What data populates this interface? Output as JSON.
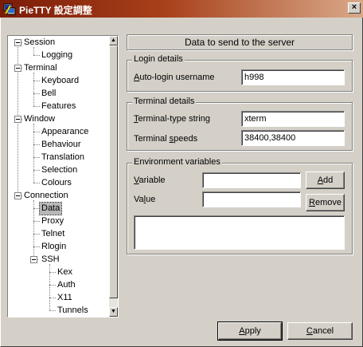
{
  "window": {
    "title": "PieTTY 設定調整",
    "close_glyph": "×"
  },
  "tree": {
    "items": [
      {
        "label": "Session",
        "level": 0,
        "expandable": true
      },
      {
        "label": "Logging",
        "level": 1
      },
      {
        "label": "Terminal",
        "level": 0,
        "expandable": true
      },
      {
        "label": "Keyboard",
        "level": 1
      },
      {
        "label": "Bell",
        "level": 1
      },
      {
        "label": "Features",
        "level": 1
      },
      {
        "label": "Window",
        "level": 0,
        "expandable": true
      },
      {
        "label": "Appearance",
        "level": 1
      },
      {
        "label": "Behaviour",
        "level": 1
      },
      {
        "label": "Translation",
        "level": 1
      },
      {
        "label": "Selection",
        "level": 1
      },
      {
        "label": "Colours",
        "level": 1
      },
      {
        "label": "Connection",
        "level": 0,
        "expandable": true
      },
      {
        "label": "Data",
        "level": 1,
        "selected": true
      },
      {
        "label": "Proxy",
        "level": 1
      },
      {
        "label": "Telnet",
        "level": 1
      },
      {
        "label": "Rlogin",
        "level": 1
      },
      {
        "label": "SSH",
        "level": 1,
        "expandable": true
      },
      {
        "label": "Kex",
        "level": 2
      },
      {
        "label": "Auth",
        "level": 2
      },
      {
        "label": "X11",
        "level": 2
      },
      {
        "label": "Tunnels",
        "level": 2
      }
    ],
    "scroll_up_glyph": "▲",
    "scroll_down_glyph": "▼"
  },
  "panel": {
    "header": "Data to send to the server",
    "login": {
      "title": "Login details",
      "username_label_u": "A",
      "username_label_rest": "uto-login username",
      "username_value": "h998"
    },
    "terminal": {
      "title": "Terminal details",
      "type_label_u": "T",
      "type_label_rest": "erminal-type string",
      "type_value": "xterm",
      "speeds_label_pre": "Terminal ",
      "speeds_label_u": "s",
      "speeds_label_rest": "peeds",
      "speeds_value": "38400,38400"
    },
    "env": {
      "title": "Environment variables",
      "variable_label_u": "V",
      "variable_label_rest": "ariable",
      "variable_value": "",
      "value_label_pre": "Va",
      "value_label_u": "l",
      "value_label_rest": "ue",
      "value_value": "",
      "add_u": "A",
      "add_rest": "dd",
      "remove_u": "R",
      "remove_rest": "emove"
    }
  },
  "footer": {
    "apply_u": "A",
    "apply_rest": "pply",
    "cancel_u": "C",
    "cancel_rest": "ancel"
  }
}
